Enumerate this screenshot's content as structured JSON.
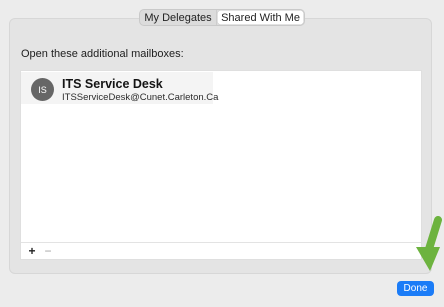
{
  "tabs": [
    {
      "label": "My Delegates"
    },
    {
      "label": "Shared With Me"
    }
  ],
  "panel": {
    "instruction": "Open these additional mailboxes:"
  },
  "mailboxes": [
    {
      "initials": "IS",
      "title": "ITS Service Desk",
      "email": "ITSServiceDesk@Cunet.Carleton.Ca"
    }
  ],
  "footer": {
    "add_label": "+",
    "remove_label": "−"
  },
  "actions": {
    "done_label": "Done"
  },
  "colors": {
    "accent": "#1b7cf7",
    "arrow": "#6db33f",
    "avatar": "#666666"
  },
  "icons": {
    "arrow": "green-arrow-icon"
  }
}
